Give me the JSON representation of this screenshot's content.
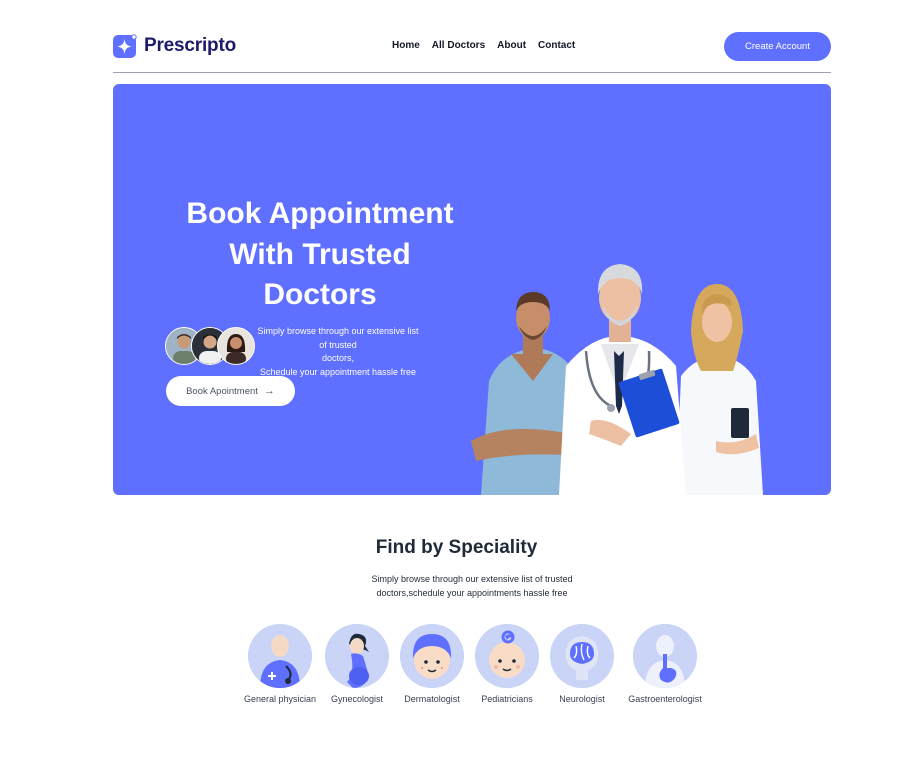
{
  "brand": {
    "name": "Prescripto",
    "color": "#5f6fff",
    "logo_icon": "sparkle-star-icon"
  },
  "nav": {
    "links": [
      "Home",
      "All Doctors",
      "About",
      "Contact"
    ],
    "cta": "Create Account"
  },
  "hero": {
    "title_line1": "Book Appointment",
    "title_line2": "With Trusted",
    "title_line3": "Doctors",
    "sub_line1": "Simply browse through our extensive list of trusted",
    "sub_line2": "doctors,",
    "sub_line3": "Schedule your appointment hassle free",
    "button": "Book Apointment",
    "button_icon": "arrow-right-icon",
    "background": "#5f6fff"
  },
  "speciality": {
    "title": "Find by Speciality",
    "sub_line1": "Simply browse through our extensive list of trusted",
    "sub_line2": "doctors,schedule your appointments hassle free",
    "items": [
      {
        "label": "General physician",
        "icon": "general-physician-icon"
      },
      {
        "label": "Gynecologist",
        "icon": "gynecologist-icon"
      },
      {
        "label": "Dermatologist",
        "icon": "dermatologist-icon"
      },
      {
        "label": "Pediatricians",
        "icon": "pediatrician-icon"
      },
      {
        "label": "Neurologist",
        "icon": "neurologist-icon"
      },
      {
        "label": "Gastroenterologist",
        "icon": "gastroenterologist-icon"
      }
    ]
  }
}
